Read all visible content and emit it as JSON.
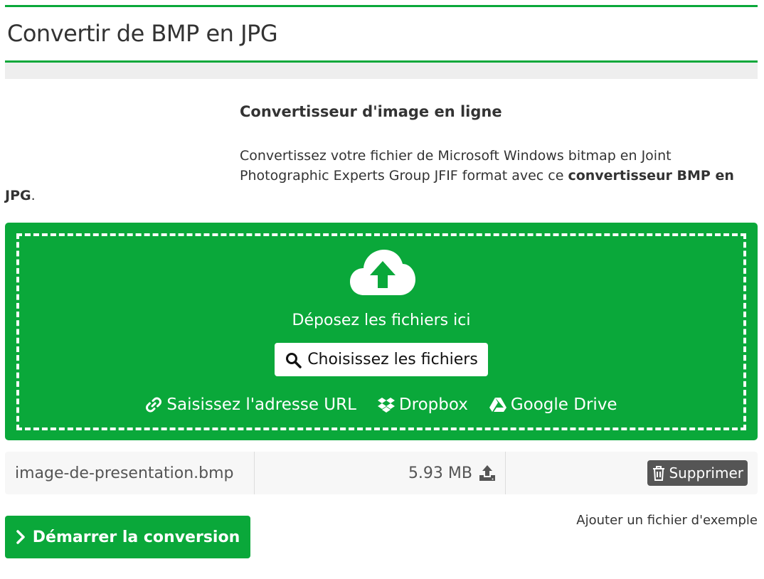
{
  "page": {
    "title": "Convertir de BMP en JPG",
    "subheading": "Convertisseur d'image en ligne",
    "intro": {
      "part1": "Convertissez votre fichier de Microsoft Windows bitmap en Joint",
      "part2": "Photographic Experts Group JFIF format avec ce ",
      "bold": "convertisseur BMP en",
      "part3_bold": "JPG",
      "part3_end": "."
    }
  },
  "upload": {
    "drop_text": "Déposez les fichiers ici",
    "choose_label": "Choisissez les fichiers",
    "sources": {
      "url": "Saisissez l'adresse URL",
      "dropbox": "Dropbox",
      "gdrive": "Google Drive"
    }
  },
  "file": {
    "name": "image-de-presentation.bmp",
    "size": "5.93 MB",
    "delete_label": "Supprimer"
  },
  "actions": {
    "start_label": "Démarrer la conversion",
    "sample_label": "Ajouter un fichier d'exemple"
  },
  "colors": {
    "accent": "#0aa83a",
    "delete_bg": "#555555"
  },
  "icons": [
    "cloud-upload-icon",
    "search-icon",
    "link-icon",
    "dropbox-icon",
    "google-drive-icon",
    "upload-icon",
    "trash-icon",
    "chevron-right-icon"
  ]
}
